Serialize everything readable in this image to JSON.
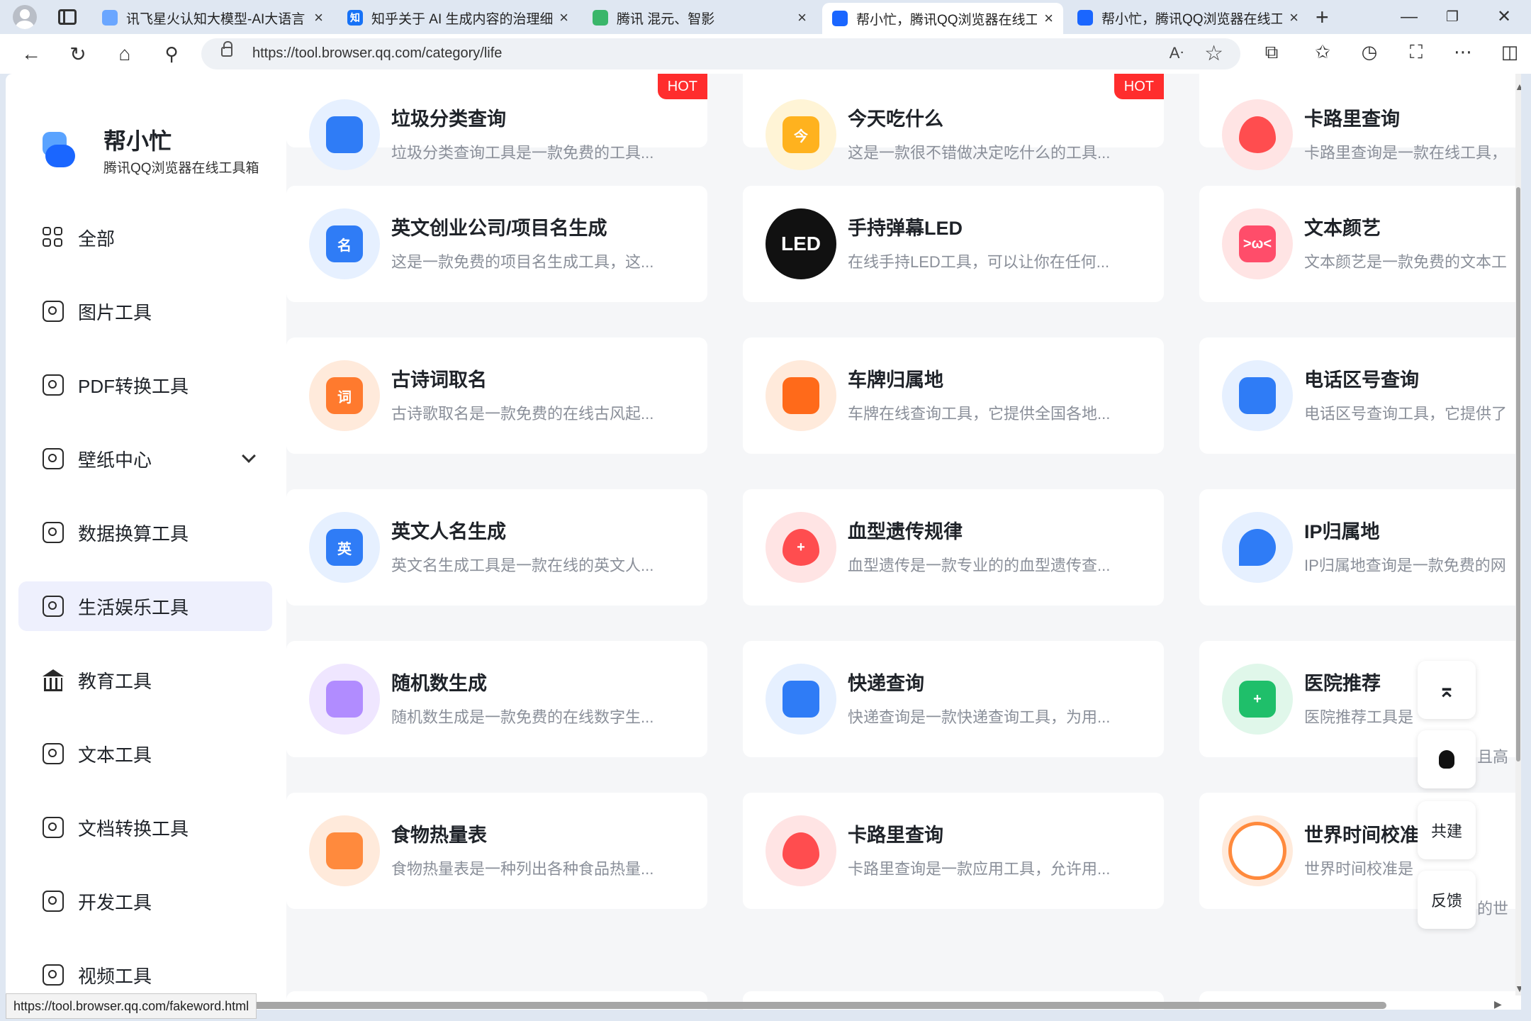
{
  "browser": {
    "tabs": [
      {
        "title": "讯飞星火认知大模型-AI大语言",
        "icon": "spark-icon",
        "color": "#6aa6ff"
      },
      {
        "title": "知乎关于 AI 生成内容的治理细",
        "icon": "zhihu-icon",
        "color": "#1772f6",
        "glyph": "知"
      },
      {
        "title": "腾讯 混元、智影",
        "icon": "hunyuan-icon",
        "color": "#3ab66a"
      },
      {
        "title": "帮小忙，腾讯QQ浏览器在线工",
        "icon": "bangxiaomang-icon",
        "color": "#1a66ff"
      },
      {
        "title": "帮小忙，腾讯QQ浏览器在线工",
        "icon": "bangxiaomang-icon",
        "color": "#1a66ff"
      }
    ],
    "url": "https://tool.browser.qq.com/category/life",
    "status_url": "https://tool.browser.qq.com/fakeword.html"
  },
  "brand": {
    "name": "帮小忙",
    "subtitle": "腾讯QQ浏览器在线工具箱"
  },
  "nav": [
    {
      "label": "全部",
      "icon": "grid-icon"
    },
    {
      "label": "图片工具",
      "icon": "image-icon"
    },
    {
      "label": "PDF转换工具",
      "icon": "pdf-icon"
    },
    {
      "label": "壁纸中心",
      "icon": "wallpaper-icon"
    },
    {
      "label": "数据换算工具",
      "icon": "chart-icon"
    },
    {
      "label": "生活娱乐工具",
      "icon": "life-icon",
      "active": true
    },
    {
      "label": "教育工具",
      "icon": "education-icon"
    },
    {
      "label": "文本工具",
      "icon": "text-icon"
    },
    {
      "label": "文档转换工具",
      "icon": "document-icon"
    },
    {
      "label": "开发工具",
      "icon": "code-icon"
    },
    {
      "label": "视频工具",
      "icon": "video-icon"
    }
  ],
  "cards": [
    {
      "title": "垃圾分类查询",
      "desc": "垃圾分类查询工具是一款免费的工具...",
      "hot": "HOT",
      "icon": "trash-bin-icon",
      "bg": "#e6f0ff",
      "fg": "#2f7cf6"
    },
    {
      "title": "今天吃什么",
      "desc": "这是一款很不错做决定吃什么的工具...",
      "hot": "HOT",
      "icon": "food-bell-icon",
      "bg": "#fff4d6",
      "fg": "#ffb21e",
      "glyph": "今"
    },
    {
      "title": "卡路里查询",
      "desc": "卡路里查询是一款在线工具，",
      "icon": "flame-icon",
      "bg": "#ffe4e4",
      "fg": "#ff4d4f"
    },
    {
      "title": "英文创业公司/项目名生成",
      "desc": "这是一款免费的项目名生成工具，这...",
      "icon": "company-name-icon",
      "bg": "#e6f0ff",
      "fg": "#2f7cf6",
      "glyph": "名"
    },
    {
      "title": "手持弹幕LED",
      "desc": "在线手持LED工具，可以让你在任何...",
      "icon": "led-icon",
      "bg": "#111111",
      "fg": "#111111",
      "glyph": "LED"
    },
    {
      "title": "文本颜艺",
      "desc": "文本颜艺是一款免费的文本工",
      "icon": "emoji-face-icon",
      "bg": "#ffe4e4",
      "fg": "#ff4d6a",
      "glyph": ">ω<"
    },
    {
      "title": "古诗词取名",
      "desc": "古诗歌取名是一款免费的在线古风起...",
      "icon": "poem-name-icon",
      "bg": "#ffeadb",
      "fg": "#ff7a2e",
      "glyph": "词"
    },
    {
      "title": "车牌归属地",
      "desc": "车牌在线查询工具，它提供全国各地...",
      "icon": "car-search-icon",
      "bg": "#ffeadb",
      "fg": "#ff6a1a"
    },
    {
      "title": "电话区号查询",
      "desc": "电话区号查询工具，它提供了",
      "icon": "phone-search-icon",
      "bg": "#e6f0ff",
      "fg": "#2f7cf6"
    },
    {
      "title": "英文人名生成",
      "desc": "英文名生成工具是一款在线的英文人...",
      "icon": "person-name-icon",
      "bg": "#e6f0ff",
      "fg": "#2f7cf6",
      "glyph": "英"
    },
    {
      "title": "血型遗传规律",
      "desc": "血型遗传是一款专业的的血型遗传查...",
      "icon": "blood-drop-icon",
      "bg": "#ffe4e4",
      "fg": "#ff4d4f",
      "glyph": "+"
    },
    {
      "title": "IP归属地",
      "desc": "IP归属地查询是一款免费的网",
      "icon": "location-pin-icon",
      "bg": "#e6f0ff",
      "fg": "#2f7cf6"
    },
    {
      "title": "随机数生成",
      "desc": "随机数生成是一款免费的在线数字生...",
      "icon": "dice-icon",
      "bg": "#efe6ff",
      "fg": "#b18cff"
    },
    {
      "title": "快递查询",
      "desc": "快递查询是一款快递查询工具，为用...",
      "icon": "delivery-truck-icon",
      "bg": "#e6f0ff",
      "fg": "#2f7cf6"
    },
    {
      "title": "医院推荐",
      "desc": "医院推荐工具是",
      "icon": "hospital-icon",
      "bg": "#e0f7ea",
      "fg": "#1fbf6a",
      "glyph": "+"
    },
    {
      "title": "食物热量表",
      "desc": "食物热量表是一种列出各种食品热量...",
      "icon": "burger-icon",
      "bg": "#ffeadb",
      "fg": "#ff8a3d"
    },
    {
      "title": "卡路里查询",
      "desc": "卡路里查询是一款应用工具，允许用...",
      "icon": "flame-icon",
      "bg": "#ffe4e4",
      "fg": "#ff4d4f"
    },
    {
      "title": "世界时间校准",
      "desc": "世界时间校准是",
      "icon": "clock-icon",
      "bg": "#ffeadb",
      "fg": "#ff8a3d"
    }
  ],
  "card_peeks": {
    "hospital_tail": "且高",
    "worldtime_tail": "的世"
  },
  "floating": {
    "top_label": "",
    "cocreate": "共建",
    "feedback": "反馈"
  }
}
